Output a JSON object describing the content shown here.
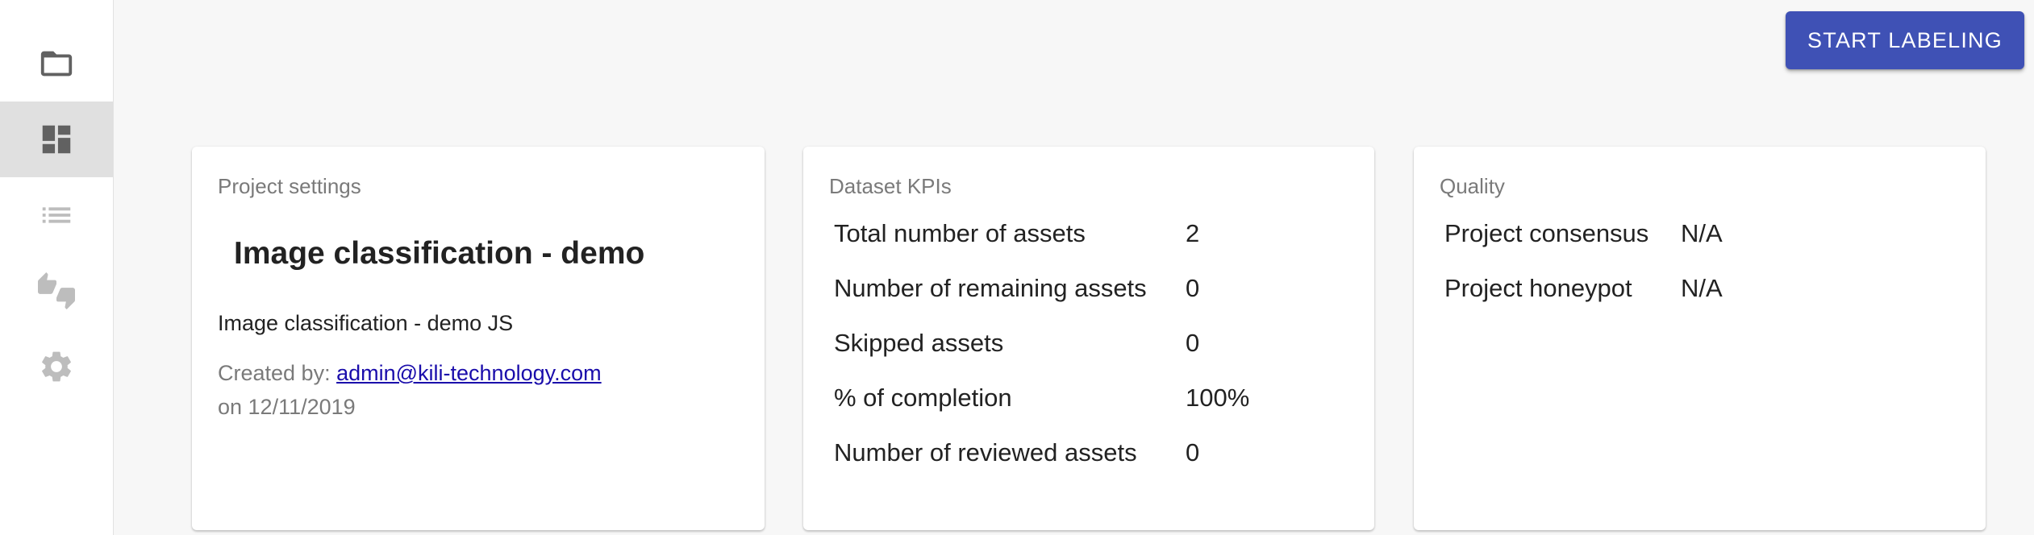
{
  "sidebar": {
    "items": [
      {
        "name": "projects",
        "icon": "folder-icon"
      },
      {
        "name": "dashboard",
        "icon": "dashboard-icon",
        "active": true
      },
      {
        "name": "queue",
        "icon": "list-icon"
      },
      {
        "name": "review",
        "icon": "thumbs-up-down-icon"
      },
      {
        "name": "settings",
        "icon": "gear-icon"
      }
    ]
  },
  "header": {
    "start_label": "START LABELING"
  },
  "project_settings": {
    "title": "Project settings",
    "name": "Image classification - demo",
    "description": "Image classification - demo JS",
    "created_by_label": "Created by:",
    "created_by_email": "admin@kili-technology.com",
    "created_on": "on 12/11/2019"
  },
  "dataset_kpis": {
    "title": "Dataset KPIs",
    "rows": [
      {
        "label": "Total number of assets",
        "value": "2"
      },
      {
        "label": "Number of remaining assets",
        "value": "0"
      },
      {
        "label": "Skipped assets",
        "value": "0"
      },
      {
        "label": "% of completion",
        "value": "100%"
      },
      {
        "label": "Number of reviewed assets",
        "value": "0"
      }
    ]
  },
  "quality": {
    "title": "Quality",
    "rows": [
      {
        "label": "Project consensus",
        "value": "N/A"
      },
      {
        "label": "Project honeypot",
        "value": "N/A"
      }
    ]
  },
  "colors": {
    "accent": "#3f51b5",
    "icon_dark": "#616161",
    "icon_light": "#bdbdbd"
  }
}
